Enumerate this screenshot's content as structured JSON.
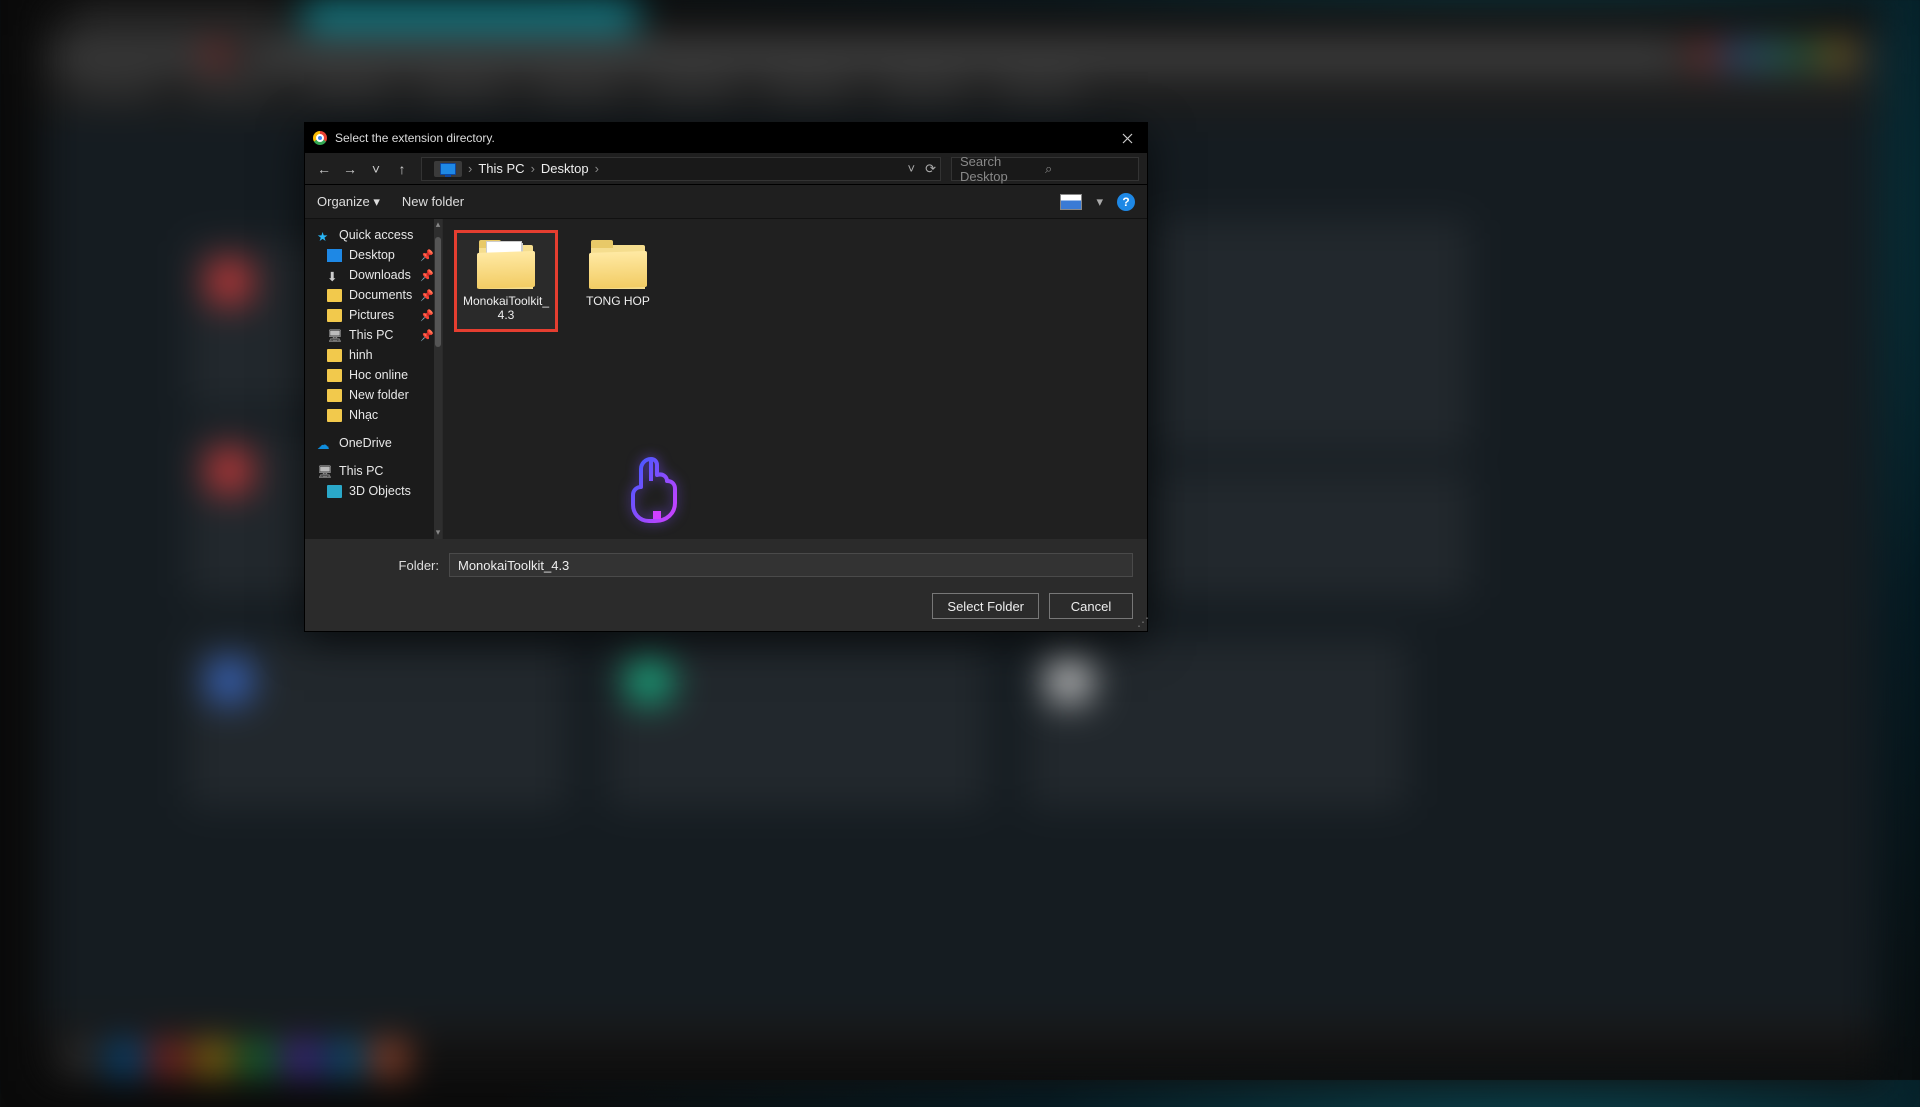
{
  "dialog": {
    "title": "Select the extension directory.",
    "nav": {
      "pc_label": "This PC",
      "crumbs": [
        "This PC",
        "Desktop"
      ]
    },
    "search": {
      "placeholder": "Search Desktop"
    },
    "toolbar": {
      "organize": "Organize",
      "new_folder": "New folder",
      "help": "?"
    },
    "tree": {
      "quick_access": "Quick access",
      "items_pinned": [
        {
          "label": "Desktop",
          "icon": "desktop"
        },
        {
          "label": "Downloads",
          "icon": "download"
        },
        {
          "label": "Documents",
          "icon": "folder"
        },
        {
          "label": "Pictures",
          "icon": "folder"
        },
        {
          "label": "This PC",
          "icon": "pc"
        },
        {
          "label": "hinh",
          "icon": "folder"
        },
        {
          "label": "Hoc online",
          "icon": "folder"
        },
        {
          "label": "New folder",
          "icon": "folder"
        },
        {
          "label": "Nhạc",
          "icon": "folder"
        }
      ],
      "onedrive": "OneDrive",
      "this_pc": "This PC",
      "children_pc": [
        {
          "label": "3D Objects",
          "icon": "folder"
        }
      ]
    },
    "files": [
      {
        "name": "MonokaiToolkit_4.3",
        "selected": true,
        "has_papers": true
      },
      {
        "name": "TONG HOP",
        "selected": false,
        "has_papers": false
      }
    ],
    "footer": {
      "folder_label": "Folder:",
      "folder_value": "MonokaiToolkit_4.3",
      "select": "Select Folder",
      "cancel": "Cancel"
    }
  }
}
